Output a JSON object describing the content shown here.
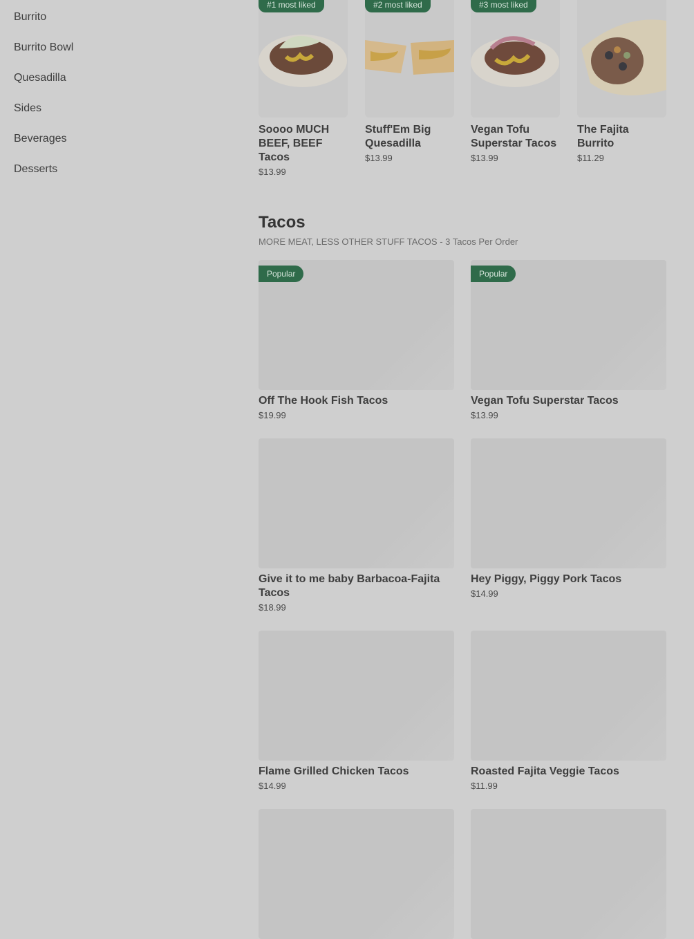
{
  "sidebar": {
    "items": [
      {
        "label": "Burrito"
      },
      {
        "label": "Burrito Bowl"
      },
      {
        "label": "Quesadilla"
      },
      {
        "label": "Sides"
      },
      {
        "label": "Beverages"
      },
      {
        "label": "Desserts"
      }
    ]
  },
  "most_liked": [
    {
      "badge": "#1 most liked",
      "name": "Soooo MUCH BEEF, BEEF Tacos",
      "price": "$13.99",
      "image": "beef-tacos-image"
    },
    {
      "badge": "#2 most liked",
      "name": "Stuff'Em Big Quesadilla",
      "price": "$13.99",
      "image": "quesadilla-image"
    },
    {
      "badge": "#3 most liked",
      "name": "Vegan Tofu Superstar Tacos",
      "price": "$13.99",
      "image": "tofu-tacos-image"
    },
    {
      "badge": "",
      "name": "The Fajita Burrito",
      "price": "$11.29",
      "image": "fajita-burrito-image"
    }
  ],
  "section": {
    "title": "Tacos",
    "subtitle": "MORE MEAT, LESS OTHER STUFF TACOS - 3 Tacos Per Order"
  },
  "items": [
    {
      "name": "Off The Hook Fish Tacos",
      "price": "$19.99",
      "badge": "Popular"
    },
    {
      "name": "Vegan Tofu Superstar Tacos",
      "price": "$13.99",
      "badge": "Popular"
    },
    {
      "name": "Give it to me baby Barbacoa-Fajita Tacos",
      "price": "$18.99",
      "badge": ""
    },
    {
      "name": "Hey Piggy, Piggy Pork Tacos",
      "price": "$14.99",
      "badge": ""
    },
    {
      "name": "Flame Grilled Chicken Tacos",
      "price": "$14.99",
      "badge": ""
    },
    {
      "name": "Roasted Fajita Veggie Tacos",
      "price": "$11.99",
      "badge": ""
    },
    {
      "name": "",
      "price": "",
      "badge": ""
    },
    {
      "name": "",
      "price": "",
      "badge": ""
    }
  ]
}
